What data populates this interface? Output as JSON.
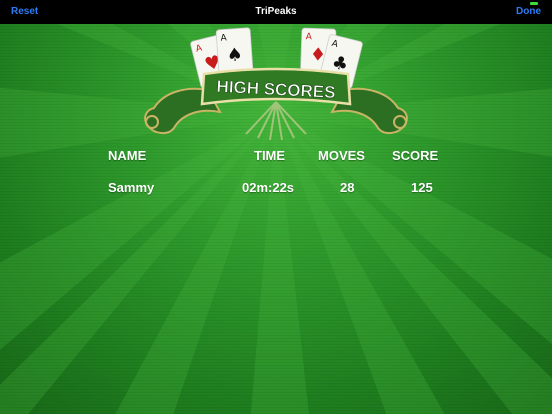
{
  "topbar": {
    "reset_label": "Reset",
    "title": "TriPeaks",
    "done_label": "Done"
  },
  "banner": {
    "text": "HIGH SCORES",
    "cards": [
      "A♥",
      "A♠",
      "A♦",
      "A♣"
    ]
  },
  "table": {
    "headers": {
      "name": "NAME",
      "time": "TIME",
      "moves": "MOVES",
      "score": "SCORE"
    },
    "rows": [
      {
        "name": "Sammy",
        "time": "02m:22s",
        "moves": "28",
        "score": "125"
      }
    ]
  },
  "colors": {
    "felt": "#2e9a2c",
    "ribbon": "#2f7a23",
    "link": "#2d7cf6"
  }
}
